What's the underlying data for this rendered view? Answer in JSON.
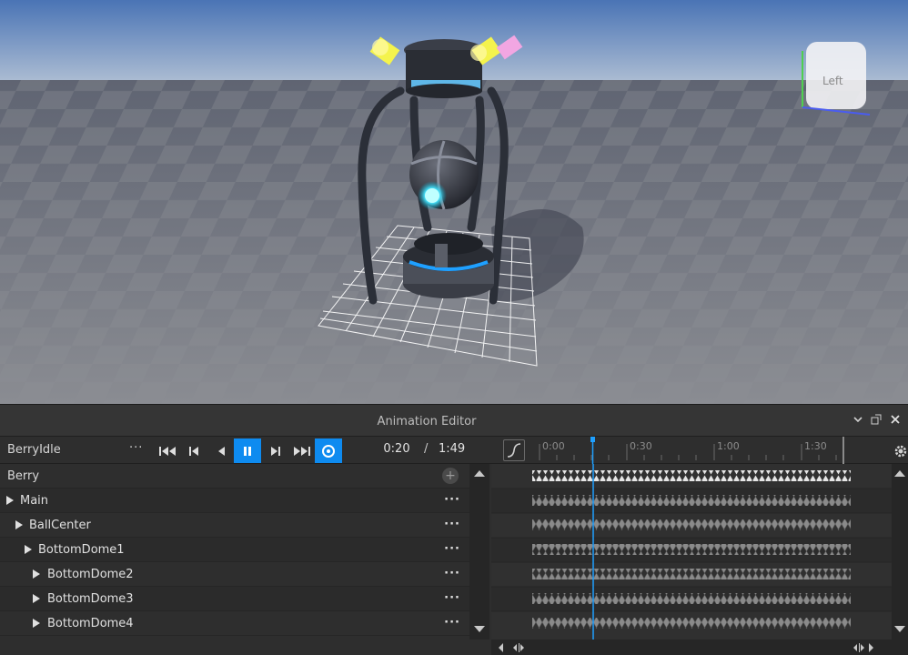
{
  "window": {
    "title": "Animation Editor"
  },
  "toolbar": {
    "animation_name": "BerryIdle",
    "more_label": "···",
    "current_time": "0:20",
    "separator": "/",
    "total_length": "1:49"
  },
  "timeline": {
    "ticks": [
      "0:00",
      "0:30",
      "1:00",
      "1:30"
    ],
    "playhead_time": "0:20"
  },
  "viewport": {
    "view_cube_label": "Left"
  },
  "tree": {
    "root": "Berry",
    "add_label": "+",
    "items": [
      {
        "label": "Main",
        "more": "···"
      },
      {
        "label": "BallCenter",
        "more": "···"
      },
      {
        "label": "BottomDome1",
        "more": "···"
      },
      {
        "label": "BottomDome2",
        "more": "···"
      },
      {
        "label": "BottomDome3",
        "more": "···"
      },
      {
        "label": "BottomDome4",
        "more": "···"
      }
    ]
  },
  "colors": {
    "accent": "#0e8bf0",
    "sky": "#a7b8d0",
    "ground": "#7d7f86"
  },
  "icons": [
    "minimize-chevron-icon",
    "dock-icon",
    "close-icon",
    "first-frame-icon",
    "prev-keyframe-icon",
    "play-reverse-icon",
    "pause-icon",
    "next-keyframe-icon",
    "last-frame-icon",
    "loop-icon",
    "curve-editor-icon",
    "settings-gear-icon"
  ]
}
